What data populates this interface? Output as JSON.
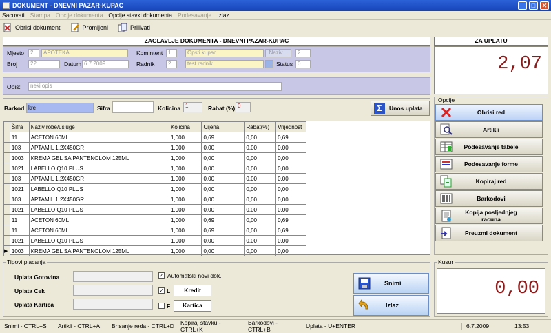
{
  "window": {
    "title": "DOKUMENT - DNEVNI PAZAR-KUPAC",
    "min": "_",
    "max": "□",
    "close": "✕"
  },
  "menu": [
    {
      "label": "Sacuvati",
      "enabled": true
    },
    {
      "label": "Stampa",
      "enabled": false
    },
    {
      "label": "Opcije dokumenta",
      "enabled": false
    },
    {
      "label": "Opcije stavki dokumenta",
      "enabled": true
    },
    {
      "label": "Podesavanje",
      "enabled": false
    },
    {
      "label": "Izlaz",
      "enabled": true
    }
  ],
  "toolbar": {
    "delete_doc": "Obrisi dokument",
    "edit": "Promijeni",
    "attach": "Prilivati"
  },
  "header": {
    "title": "ZAGLAVLJE DOKUMENTA - DNEVNI PAZAR-KUPAC",
    "mjesto_label": "Mjesto",
    "mjesto_code": "2",
    "mjesto_name": "APOTEKA",
    "komintent_label": "Komintent",
    "komintent_code": "1",
    "komintent_name": "Opsti kupac",
    "naziv_btn": "Naziv ...",
    "komintent_extra": "2",
    "broj_label": "Broj",
    "broj_value": "22",
    "datum_label": "Datum",
    "datum_value": "6.7.2009",
    "radnik_label": "Radnik",
    "radnik_code": "2",
    "radnik_name": "test radnik",
    "radnik_btn": "...",
    "status_label": "Status",
    "status_value": "0",
    "opis_label": "Opis:",
    "opis_value": "neki opis"
  },
  "za_uplatu": {
    "title": "ZA UPLATU",
    "amount": "2,07"
  },
  "entry": {
    "barkod_label": "Barkod",
    "barkod_value": "kre",
    "sifra_label": "Sifra",
    "sifra_value": "",
    "kolicina_label": "Kolicina",
    "kolicina_value": "1",
    "rabat_label": "Rabat (%)",
    "rabat_value": "0",
    "unos_btn": "Unos uplata"
  },
  "grid": {
    "columns": [
      "Šifra",
      "Naziv robe/usluge",
      "Kolicina",
      "Cijena",
      "Rabat(%)",
      "Vrijednost"
    ],
    "rows": [
      {
        "sifra": "11",
        "naziv": "ACETON 60ML",
        "kolicina": "1,000",
        "cijena": "0,69",
        "rabat": "0,00",
        "vrijednost": "0,69",
        "current": false
      },
      {
        "sifra": "103",
        "naziv": "APTAMIL 1.2X450GR",
        "kolicina": "1,000",
        "cijena": "0,00",
        "rabat": "0,00",
        "vrijednost": "0,00",
        "current": false
      },
      {
        "sifra": "1003",
        "naziv": "KREMA GEL SA PANTENOLOM 125ML",
        "kolicina": "1,000",
        "cijena": "0,00",
        "rabat": "0,00",
        "vrijednost": "0,00",
        "current": false
      },
      {
        "sifra": "1021",
        "naziv": "LABELLO Q10 PLUS",
        "kolicina": "1,000",
        "cijena": "0,00",
        "rabat": "0,00",
        "vrijednost": "0,00",
        "current": false
      },
      {
        "sifra": "103",
        "naziv": "APTAMIL 1.2X450GR",
        "kolicina": "1,000",
        "cijena": "0,00",
        "rabat": "0,00",
        "vrijednost": "0,00",
        "current": false
      },
      {
        "sifra": "1021",
        "naziv": "LABELLO Q10 PLUS",
        "kolicina": "1,000",
        "cijena": "0,00",
        "rabat": "0,00",
        "vrijednost": "0,00",
        "current": false
      },
      {
        "sifra": "103",
        "naziv": "APTAMIL 1.2X450GR",
        "kolicina": "1,000",
        "cijena": "0,00",
        "rabat": "0,00",
        "vrijednost": "0,00",
        "current": false
      },
      {
        "sifra": "1021",
        "naziv": "LABELLO Q10 PLUS",
        "kolicina": "1,000",
        "cijena": "0,00",
        "rabat": "0,00",
        "vrijednost": "0,00",
        "current": false
      },
      {
        "sifra": "11",
        "naziv": "ACETON 60ML",
        "kolicina": "1,000",
        "cijena": "0,69",
        "rabat": "0,00",
        "vrijednost": "0,69",
        "current": false
      },
      {
        "sifra": "11",
        "naziv": "ACETON 60ML",
        "kolicina": "1,000",
        "cijena": "0,69",
        "rabat": "0,00",
        "vrijednost": "0,69",
        "current": false
      },
      {
        "sifra": "1021",
        "naziv": "LABELLO Q10 PLUS",
        "kolicina": "1,000",
        "cijena": "0,00",
        "rabat": "0,00",
        "vrijednost": "0,00",
        "current": false
      },
      {
        "sifra": "1003",
        "naziv": "KREMA GEL SA PANTENOLOM 125ML",
        "kolicina": "1,000",
        "cijena": "0,00",
        "rabat": "0,00",
        "vrijednost": "0,00",
        "current": true
      }
    ]
  },
  "opcije": {
    "title": "Opcije",
    "buttons": [
      {
        "label": "Obrisi red",
        "icon": "delete-x-icon"
      },
      {
        "label": "Artikli",
        "icon": "magnifier-icon"
      },
      {
        "label": "Podesavanje tabele",
        "icon": "table-settings-icon"
      },
      {
        "label": "Podesavanje forme",
        "icon": "form-settings-icon"
      },
      {
        "label": "Kopiraj red",
        "icon": "copy-row-icon"
      },
      {
        "label": "Barkodovi",
        "icon": "barcode-icon"
      },
      {
        "label": "Kopija posljednjeg racuna",
        "icon": "receipt-icon"
      },
      {
        "label": "Preuzmi dokument",
        "icon": "import-document-icon"
      }
    ]
  },
  "payments": {
    "title": "Tipovi placanja",
    "gotovina_label": "Uplata Gotovina",
    "cek_label": "Uplata Cek",
    "kartica_label": "Uplata Kartica",
    "auto_new_label": "Automatski novi dok.",
    "auto_new_checked": true,
    "l_label": "L",
    "l_checked": true,
    "f_label": "F",
    "f_checked": false,
    "kredit_btn": "Kredit",
    "kartica_btn": "Kartica",
    "snimi_btn": "Snimi",
    "izlaz_btn": "Izlaz"
  },
  "kusur": {
    "title": "Kusur",
    "amount": "0,00"
  },
  "statusbar": {
    "snimi": "Snimi - CTRL+S",
    "artikli": "Artikli - CTRL+A",
    "brisanje": "Brisanje reda - CTRL+D",
    "kopiraj": "Kopiraj stavku - CTRL+K",
    "barkodovi": "Barkodovi - CTRL+B",
    "uplata": "Uplata - U+ENTER",
    "date": "6.7.2009",
    "time": "13:53"
  },
  "colors": {
    "title_blue": "#1843b8",
    "panel_lilac": "#c8c8e6",
    "amount_red": "#8b1a1a",
    "barkod_blue": "#a8b8f0"
  }
}
